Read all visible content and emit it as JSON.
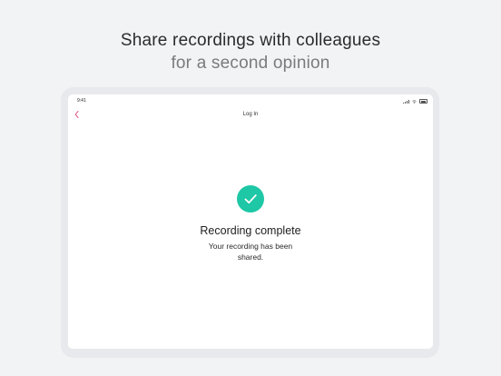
{
  "headline": {
    "line1": "Share recordings with colleagues",
    "line2": "for a second opinion"
  },
  "status_bar": {
    "time": "9:41"
  },
  "nav": {
    "title": "Log In",
    "back_icon": "chevron-left-icon",
    "accent_color": "#e0457b"
  },
  "main": {
    "success_icon": "checkmark-icon",
    "success_color": "#1ec7a6",
    "title": "Recording complete",
    "message": "Your recording has been shared."
  }
}
